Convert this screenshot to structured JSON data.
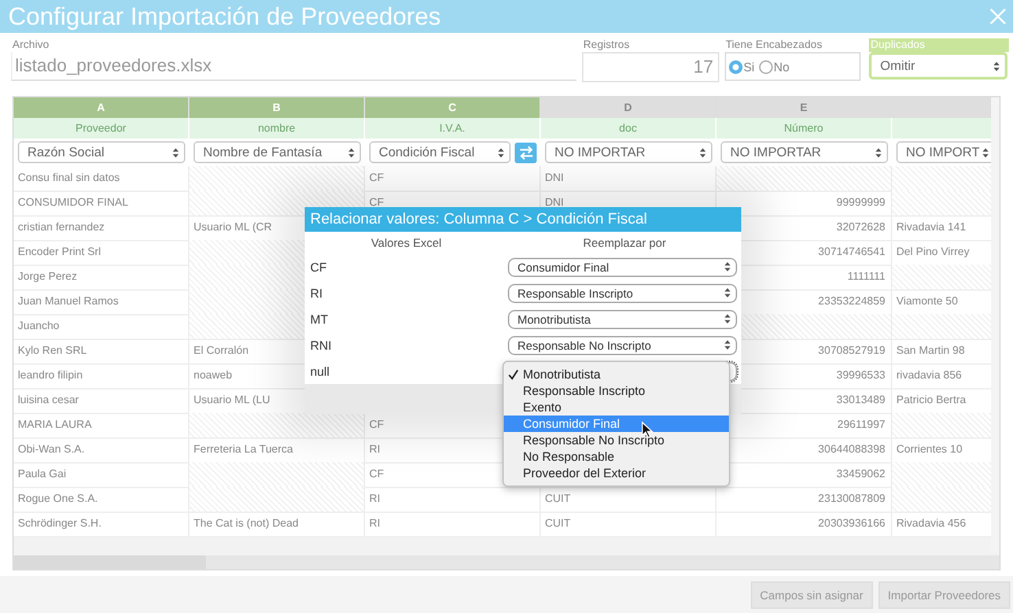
{
  "window": {
    "title": "Configurar Importación de Proveedores"
  },
  "form": {
    "file": {
      "label": "Archivo",
      "value": "listado_proveedores.xlsx"
    },
    "records": {
      "label": "Registros",
      "value": "17"
    },
    "headers": {
      "label": "Tiene Encabezados",
      "options": [
        {
          "label": "Si",
          "selected": true
        },
        {
          "label": "No",
          "selected": false
        }
      ]
    },
    "duplicates": {
      "label": "Duplicados",
      "value": "Omitir"
    }
  },
  "table": {
    "columns": [
      {
        "letter": "A",
        "name": "Proveedor",
        "mapping": "Razón Social",
        "assigned": true,
        "swap_button": false
      },
      {
        "letter": "B",
        "name": "nombre",
        "mapping": "Nombre de Fantasía",
        "assigned": true,
        "swap_button": false
      },
      {
        "letter": "C",
        "name": "I.V.A.",
        "mapping": "Condición Fiscal",
        "assigned": true,
        "swap_button": true
      },
      {
        "letter": "D",
        "name": "doc",
        "mapping": "NO IMPORTAR",
        "assigned": false,
        "swap_button": false
      },
      {
        "letter": "E",
        "name": "Número",
        "mapping": "NO IMPORTAR",
        "assigned": false,
        "swap_button": false
      },
      {
        "mapping": "NO IMPORT",
        "assigned": false,
        "swap_button": false
      }
    ],
    "rows": [
      {
        "cells": [
          "Consu final sin datos",
          null,
          "CF",
          "DNI",
          null,
          null
        ]
      },
      {
        "cells": [
          "CONSUMIDOR FINAL",
          null,
          "CF",
          "DNI",
          "99999999",
          null
        ]
      },
      {
        "cells": [
          "cristian fernandez",
          "Usuario ML (CR",
          null,
          null,
          "32072628",
          "Rivadavia 141"
        ]
      },
      {
        "cells": [
          "Encoder Print Srl",
          null,
          null,
          null,
          "30714746541",
          "Del Pino Virrey"
        ]
      },
      {
        "cells": [
          "Jorge Perez",
          null,
          null,
          null,
          "1111111",
          null
        ]
      },
      {
        "cells": [
          "Juan Manuel Ramos",
          null,
          null,
          null,
          "23353224859",
          "Viamonte 50"
        ]
      },
      {
        "cells": [
          "Juancho",
          null,
          null,
          null,
          null,
          null
        ]
      },
      {
        "cells": [
          "Kylo Ren SRL",
          "El Corralón",
          null,
          null,
          "30708527919",
          "San Martin 98"
        ]
      },
      {
        "cells": [
          "leandro filipin",
          "noaweb",
          null,
          null,
          "39996533",
          "rivadavia 856"
        ]
      },
      {
        "cells": [
          "luisina cesar",
          "Usuario ML (LU",
          null,
          null,
          "33013489",
          "Patricio Bertra"
        ]
      },
      {
        "cells": [
          "MARIA LAURA",
          null,
          "CF",
          null,
          "29611997",
          null
        ]
      },
      {
        "cells": [
          "Obi-Wan S.A.",
          "Ferreteria La Tuerca",
          "RI",
          null,
          "30644088398",
          "Corrientes 10"
        ]
      },
      {
        "cells": [
          "Paula Gai",
          null,
          "CF",
          null,
          "33459062",
          null
        ]
      },
      {
        "cells": [
          "Rogue One S.A.",
          null,
          "RI",
          "CUIT",
          "23130087809",
          null
        ]
      },
      {
        "cells": [
          "Schrödinger S.H.",
          "The Cat is (not) Dead",
          "RI",
          "CUIT",
          "20303936166",
          "Rivadavia 456"
        ]
      }
    ]
  },
  "dialog": {
    "title": "Relacionar valores: Columna C > Condición Fiscal",
    "headers": [
      "Valores Excel",
      "Reemplazar por"
    ],
    "rows": [
      {
        "value": "CF",
        "replacement": "Consumidor Final",
        "open": false
      },
      {
        "value": "RI",
        "replacement": "Responsable Inscripto",
        "open": false
      },
      {
        "value": "MT",
        "replacement": "Monotributista",
        "open": false
      },
      {
        "value": "RNI",
        "replacement": "Responsable No Inscripto",
        "open": false
      },
      {
        "value": "null",
        "open": true
      }
    ],
    "dropdown": [
      {
        "label": "Monotributista",
        "selected": true,
        "hovered": false
      },
      {
        "label": "Responsable Inscripto",
        "selected": false,
        "hovered": false
      },
      {
        "label": "Exento",
        "selected": false,
        "hovered": false
      },
      {
        "label": "Consumidor Final",
        "selected": false,
        "hovered": true
      },
      {
        "label": "Responsable No Inscripto",
        "selected": false,
        "hovered": false
      },
      {
        "label": "No Responsable",
        "selected": false,
        "hovered": false
      },
      {
        "label": "Proveedor del Exterior",
        "selected": false,
        "hovered": false
      }
    ]
  },
  "footer": {
    "buttons": [
      {
        "label": "Campos sin asignar",
        "disabled": true
      },
      {
        "label": "Importar Proveedores",
        "disabled": true
      }
    ]
  }
}
